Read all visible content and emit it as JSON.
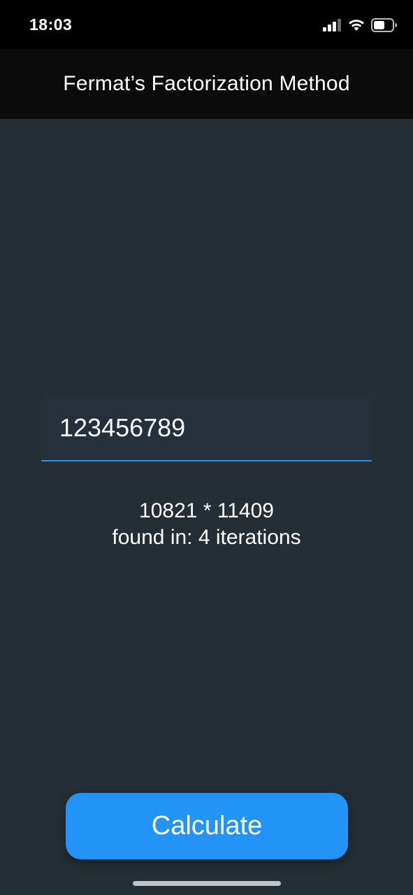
{
  "status_bar": {
    "time": "18:03",
    "icons": [
      "cellular-signal-icon",
      "wifi-icon",
      "battery-icon"
    ]
  },
  "header": {
    "title": "Fermat’s Factorization Method"
  },
  "input": {
    "value": "123456789"
  },
  "result": {
    "factors": "10821 * 11409",
    "iterations": "found in: 4 iterations"
  },
  "actions": {
    "calculate_label": "Calculate"
  },
  "colors": {
    "background": "#252d35",
    "header": "#0b0b0b",
    "accent": "#2393f7",
    "input_underline": "#2f8ee6"
  }
}
